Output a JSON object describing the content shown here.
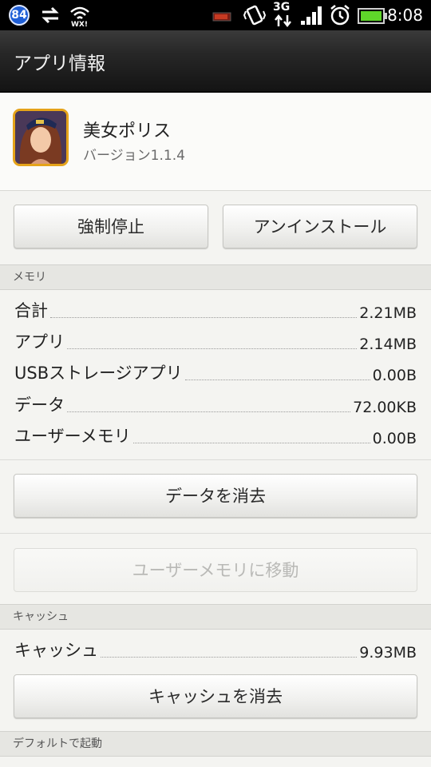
{
  "status_bar": {
    "badge": "84",
    "network": "3G",
    "time": "8:08",
    "icons": [
      "notification-badge-icon",
      "sync-arrows-icon",
      "wifi-icon",
      "battery-small-icon",
      "vibrate-icon",
      "network-3g-icon",
      "signal-icon",
      "alarm-icon",
      "battery-icon"
    ]
  },
  "action_bar": {
    "title": "アプリ情報"
  },
  "app": {
    "name": "美女ポリス",
    "version": "バージョン1.1.4"
  },
  "buttons": {
    "force_stop": "強制停止",
    "uninstall": "アンインストール",
    "clear_data": "データを消去",
    "move_to_user_memory": "ユーザーメモリに移動",
    "clear_cache": "キャッシュを消去"
  },
  "memory": {
    "header": "メモリ",
    "rows": [
      {
        "label": "合計",
        "value": "2.21MB"
      },
      {
        "label": "アプリ",
        "value": "2.14MB"
      },
      {
        "label": "USBストレージアプリ",
        "value": "0.00B"
      },
      {
        "label": "データ",
        "value": "72.00KB"
      },
      {
        "label": "ユーザーメモリ",
        "value": "0.00B"
      }
    ]
  },
  "cache": {
    "header": "キャッシュ",
    "rows": [
      {
        "label": "キャッシュ",
        "value": "9.93MB"
      }
    ]
  },
  "launch_default": {
    "header": "デフォルトで起動"
  },
  "colors": {
    "status_bar_bg": "#000000",
    "action_bar_bg": "#262626",
    "section_header_bg": "#e6e6e2",
    "battery_green": "#5fd62a",
    "badge_blue": "#1f5fd6",
    "app_icon_border": "#e5a31a"
  }
}
